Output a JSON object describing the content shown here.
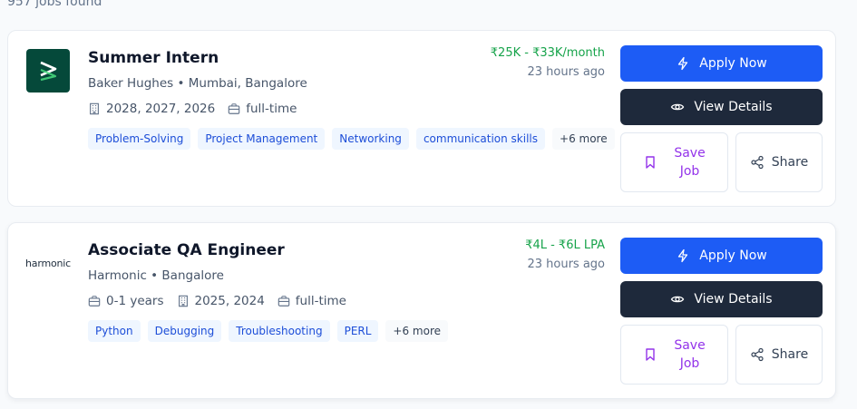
{
  "results": {
    "count_text": "957 jobs found"
  },
  "jobs": [
    {
      "logo_text": "",
      "title": "Summer Intern",
      "company_location": "Baker Hughes • Mumbai, Bangalore",
      "experience": "",
      "batch": "2028, 2027, 2026",
      "job_type": "full-time",
      "tags": [
        "Problem-Solving",
        "Project Management",
        "Networking",
        "communication skills"
      ],
      "more_tags": "+6 more",
      "salary": "₹25K - ₹33K/month",
      "posted": "23 hours ago"
    },
    {
      "logo_text": "harmonic",
      "title": "Associate QA Engineer",
      "company_location": "Harmonic • Bangalore",
      "experience": "0-1 years",
      "batch": "2025, 2024",
      "job_type": "full-time",
      "tags": [
        "Python",
        "Debugging",
        "Troubleshooting",
        "PERL"
      ],
      "more_tags": "+6 more",
      "salary": "₹4L - ₹6L LPA",
      "posted": "23 hours ago"
    }
  ],
  "actions": {
    "apply_label": "Apply Now",
    "details_label": "View Details",
    "save_line1": "Save",
    "save_line2": "Job",
    "share_label": "Share"
  },
  "icons": {
    "building": "building-icon",
    "briefcase": "briefcase-icon",
    "bolt": "bolt-icon",
    "eye": "eye-icon",
    "bookmark": "bookmark-icon",
    "share": "share-icon"
  },
  "colors": {
    "apply": "#1d5cf5",
    "details": "#1e293b",
    "save": "#9333ea",
    "salary": "#16a34a",
    "tag_bg": "#eff6ff",
    "tag_text": "#1d4ed8"
  }
}
